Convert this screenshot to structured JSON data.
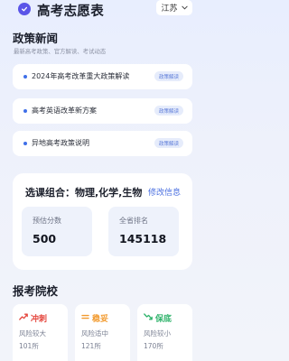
{
  "header": {
    "app_title": "高考志愿表",
    "province": "江苏",
    "logo_icon": "check-circle-icon",
    "accent": "#5b55e8"
  },
  "policy": {
    "title": "政策新闻",
    "subtitle": "最新高考政策、官方解读、考试动态",
    "items": [
      {
        "text": "2024年高考改革重大政策解读",
        "tag": "政策解读"
      },
      {
        "text": "高考英语改革新方案",
        "tag": "政策解读"
      },
      {
        "text": "异地高考政策说明",
        "tag": "政策解读"
      }
    ]
  },
  "course": {
    "label": "选课组合：物理,化学,生物",
    "edit": "修改信息",
    "stats": [
      {
        "label": "预估分数",
        "value": "500"
      },
      {
        "label": "全省排名",
        "value": "145118"
      }
    ]
  },
  "schools": {
    "title": "报考院校",
    "categories": [
      {
        "name": "冲刺",
        "risk": "风险较大",
        "count": "101所",
        "color": "#e5483f",
        "icon": "trend-up-icon"
      },
      {
        "name": "稳妥",
        "risk": "风险适中",
        "count": "121所",
        "color": "#f29a2e",
        "icon": "equal-icon"
      },
      {
        "name": "保底",
        "risk": "风险较小",
        "count": "170所",
        "color": "#2fb36b",
        "icon": "trend-down-icon"
      }
    ]
  }
}
